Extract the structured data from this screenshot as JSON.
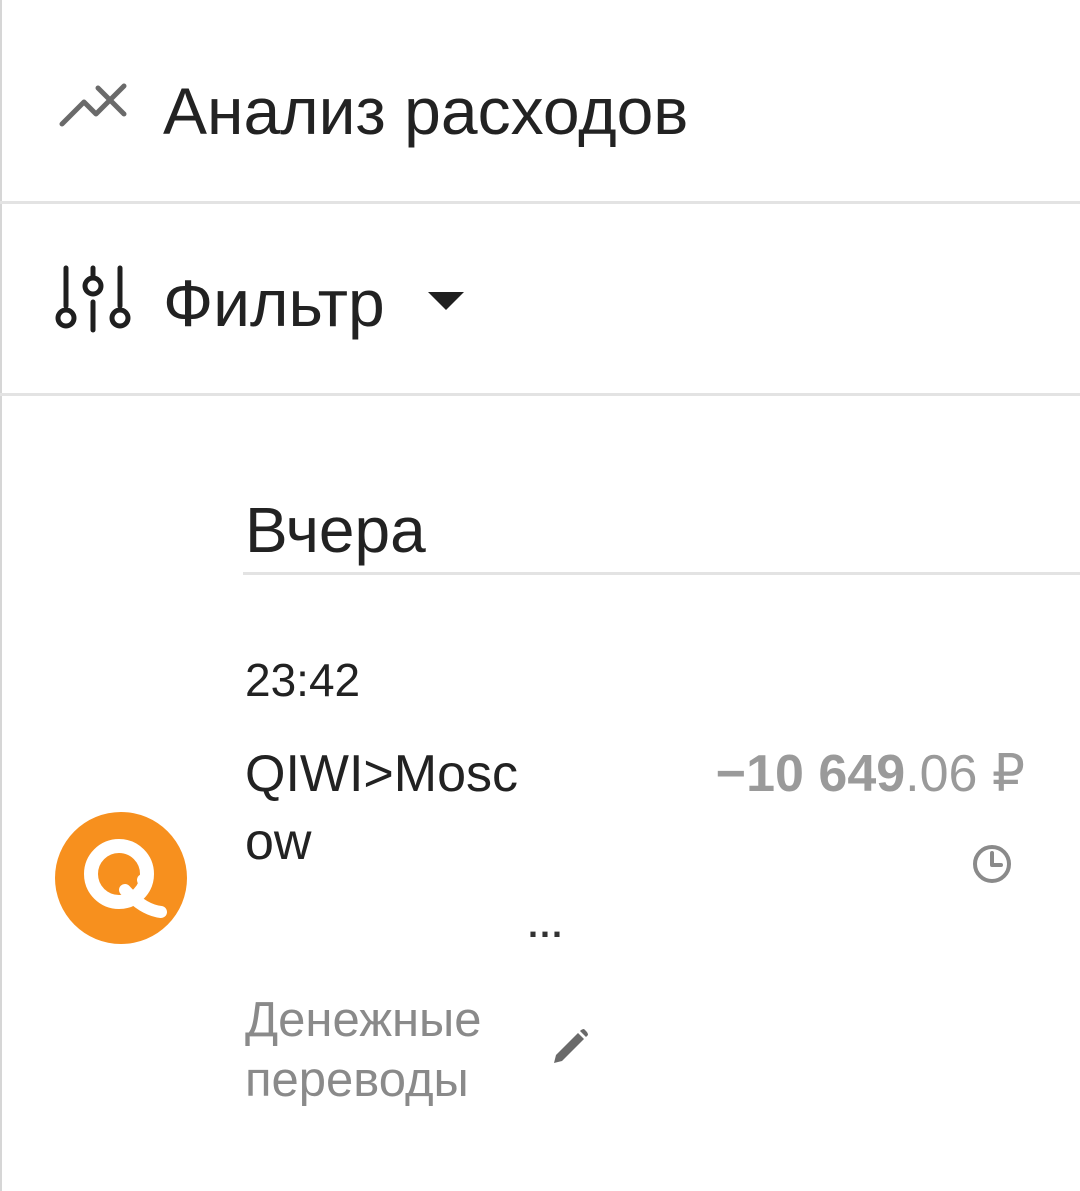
{
  "header": {
    "analysis_label": "Анализ расходов",
    "filter_label": "Фильтр"
  },
  "transactions_group": {
    "date_label": "Вчера",
    "items": [
      {
        "time": "23:42",
        "name": "QIWI>Moscow",
        "amount_integer": "−10 649",
        "amount_fraction": ".06 ₽",
        "category": "Денежные переводы",
        "logo": "qiwi-logo",
        "status_icon": "clock-icon",
        "more": "..."
      }
    ]
  },
  "icons": {
    "analysis": "trend-icon",
    "filter": "sliders-icon",
    "dropdown": "caret-down-icon",
    "edit": "pencil-icon"
  },
  "colors": {
    "qiwi_orange": "#f7901e",
    "amount_gray": "#9a9a9a",
    "category_gray": "#8a8a8a",
    "divider": "#e3e3e3"
  }
}
